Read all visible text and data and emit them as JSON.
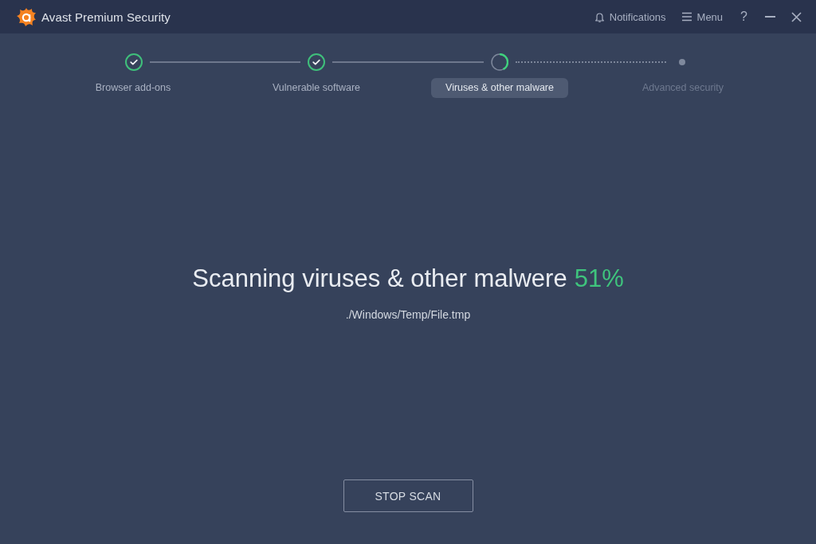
{
  "window": {
    "title": "Avast Premium Security"
  },
  "header_actions": [
    {
      "kind": "notifications",
      "label": "Notifications"
    },
    {
      "kind": "menu",
      "label": "Menu"
    }
  ],
  "window_controls": {
    "help": "?"
  },
  "steps": [
    {
      "label": "Browser add-ons",
      "completed": true,
      "selected": false
    },
    {
      "label": "Vulnerable software",
      "completed": true,
      "selected": false
    },
    {
      "label": "Viruses & other malware",
      "completed": false,
      "selected": true,
      "level": 0.42
    },
    {
      "label": "Advanced security",
      "completed": false,
      "selected": false
    }
  ],
  "scan": {
    "title": "Scanning viruses & other malwere",
    "percent": "51%",
    "current_file": "./Windows/Temp/File.tmp"
  },
  "buttons": [
    {
      "label": "STOP SCAN"
    }
  ]
}
